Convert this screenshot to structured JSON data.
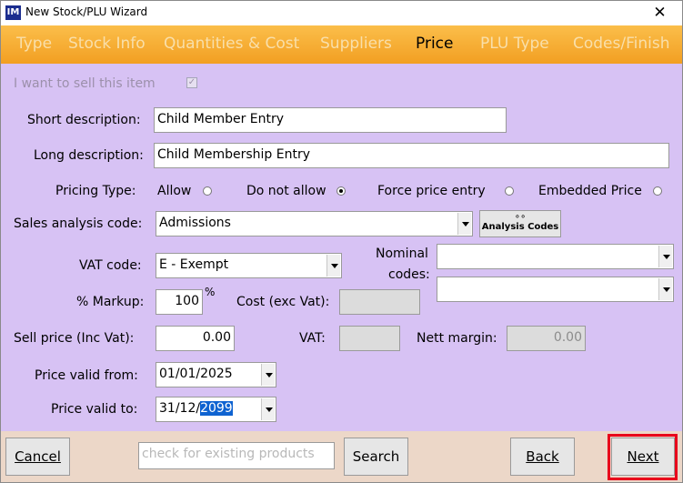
{
  "window": {
    "title": "New Stock/PLU Wizard",
    "app_icon": "IM",
    "close_glyph": "✕"
  },
  "tabs": [
    "Type",
    "Stock Info",
    "Quantities & Cost",
    "Suppliers",
    "Price",
    "PLU Type",
    "Codes/Finish"
  ],
  "active_tab": "Price",
  "form": {
    "sell_item_label": "I want to sell this item",
    "sell_item_checked": true,
    "short_desc_label": "Short description:",
    "short_desc_value": "Child Member Entry",
    "long_desc_label": "Long description:",
    "long_desc_value": "Child Membership Entry",
    "pricing_type_label": "Pricing Type:",
    "pricing_options": [
      "Allow",
      "Do not allow",
      "Force price entry",
      "Embedded Price"
    ],
    "pricing_selected": "Do not allow",
    "sales_analysis_label": "Sales analysis code:",
    "sales_analysis_value": "Admissions",
    "analysis_codes_button": "Analysis Codes",
    "vat_code_label": "VAT code:",
    "vat_code_value": "E - Exempt",
    "nominal_codes_label_1": "Nominal",
    "nominal_codes_label_2": "codes:",
    "nominal_code_1": "",
    "nominal_code_2": "",
    "markup_label": "% Markup:",
    "markup_value": "100",
    "markup_unit": "%",
    "cost_label": "Cost (exc Vat):",
    "cost_value": "",
    "sell_price_label": "Sell price (Inc Vat):",
    "sell_price_value": "0.00",
    "vat_label": "VAT:",
    "vat_value": "",
    "nett_margin_label": "Nett margin:",
    "nett_margin_value": "0.00",
    "price_valid_from_label": "Price valid from:",
    "price_valid_from_value": "01/01/2025",
    "price_valid_to_label": "Price valid to:",
    "price_valid_to_date_prefix": "31/12/",
    "price_valid_to_year_selected": "2099"
  },
  "footer": {
    "cancel_label": "Cancel",
    "search_placeholder": "check for existing products",
    "search_label": "Search",
    "back_label": "Back",
    "next_label": "Next"
  },
  "colors": {
    "form_bg": "#d7c2f4",
    "tab_bar": "#f29f22",
    "tab_inactive_text": "#f9dfaa",
    "footer_bg": "#ecd7c8",
    "highlight_frame": "#e8001b",
    "selection": "#0f63d1"
  }
}
